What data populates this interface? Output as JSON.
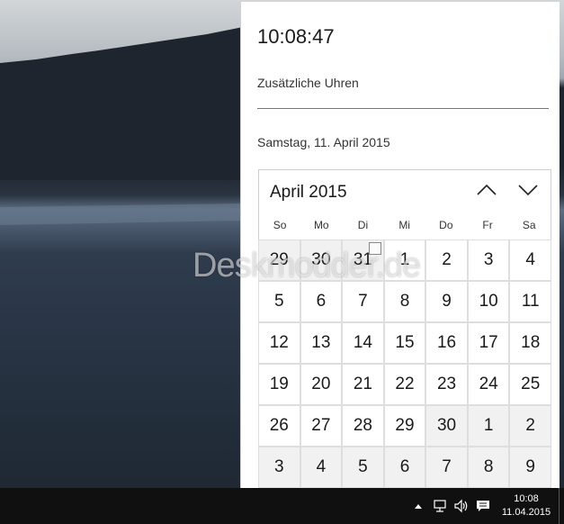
{
  "flyout": {
    "clock": "10:08:47",
    "extra_clocks_label": "Zusätzliche Uhren",
    "date_long": "Samstag, 11. April 2015"
  },
  "calendar": {
    "month_label": "April 2015",
    "weekdays": [
      "So",
      "Mo",
      "Di",
      "Mi",
      "Do",
      "Fr",
      "Sa"
    ],
    "days": [
      {
        "n": "29",
        "other": true
      },
      {
        "n": "30",
        "other": true
      },
      {
        "n": "31",
        "other": true
      },
      {
        "n": "1"
      },
      {
        "n": "2"
      },
      {
        "n": "3"
      },
      {
        "n": "4"
      },
      {
        "n": "5"
      },
      {
        "n": "6"
      },
      {
        "n": "7"
      },
      {
        "n": "8"
      },
      {
        "n": "9"
      },
      {
        "n": "10"
      },
      {
        "n": "11"
      },
      {
        "n": "12"
      },
      {
        "n": "13"
      },
      {
        "n": "14"
      },
      {
        "n": "15"
      },
      {
        "n": "16"
      },
      {
        "n": "17"
      },
      {
        "n": "18"
      },
      {
        "n": "19"
      },
      {
        "n": "20"
      },
      {
        "n": "21"
      },
      {
        "n": "22"
      },
      {
        "n": "23"
      },
      {
        "n": "24"
      },
      {
        "n": "25"
      },
      {
        "n": "26"
      },
      {
        "n": "27"
      },
      {
        "n": "28"
      },
      {
        "n": "29"
      },
      {
        "n": "30",
        "other": true
      },
      {
        "n": "1",
        "other": true
      },
      {
        "n": "2",
        "other": true
      },
      {
        "n": "3",
        "other": true
      },
      {
        "n": "4",
        "other": true
      },
      {
        "n": "5",
        "other": true
      },
      {
        "n": "6",
        "other": true
      },
      {
        "n": "7",
        "other": true
      },
      {
        "n": "8",
        "other": true
      },
      {
        "n": "9",
        "other": true
      }
    ]
  },
  "watermark": "Deskmodder.de",
  "taskbar": {
    "time": "10:08",
    "date": "11.04.2015",
    "icons": [
      "chevron-up-icon",
      "network-icon",
      "speaker-icon",
      "action-center-icon"
    ]
  }
}
